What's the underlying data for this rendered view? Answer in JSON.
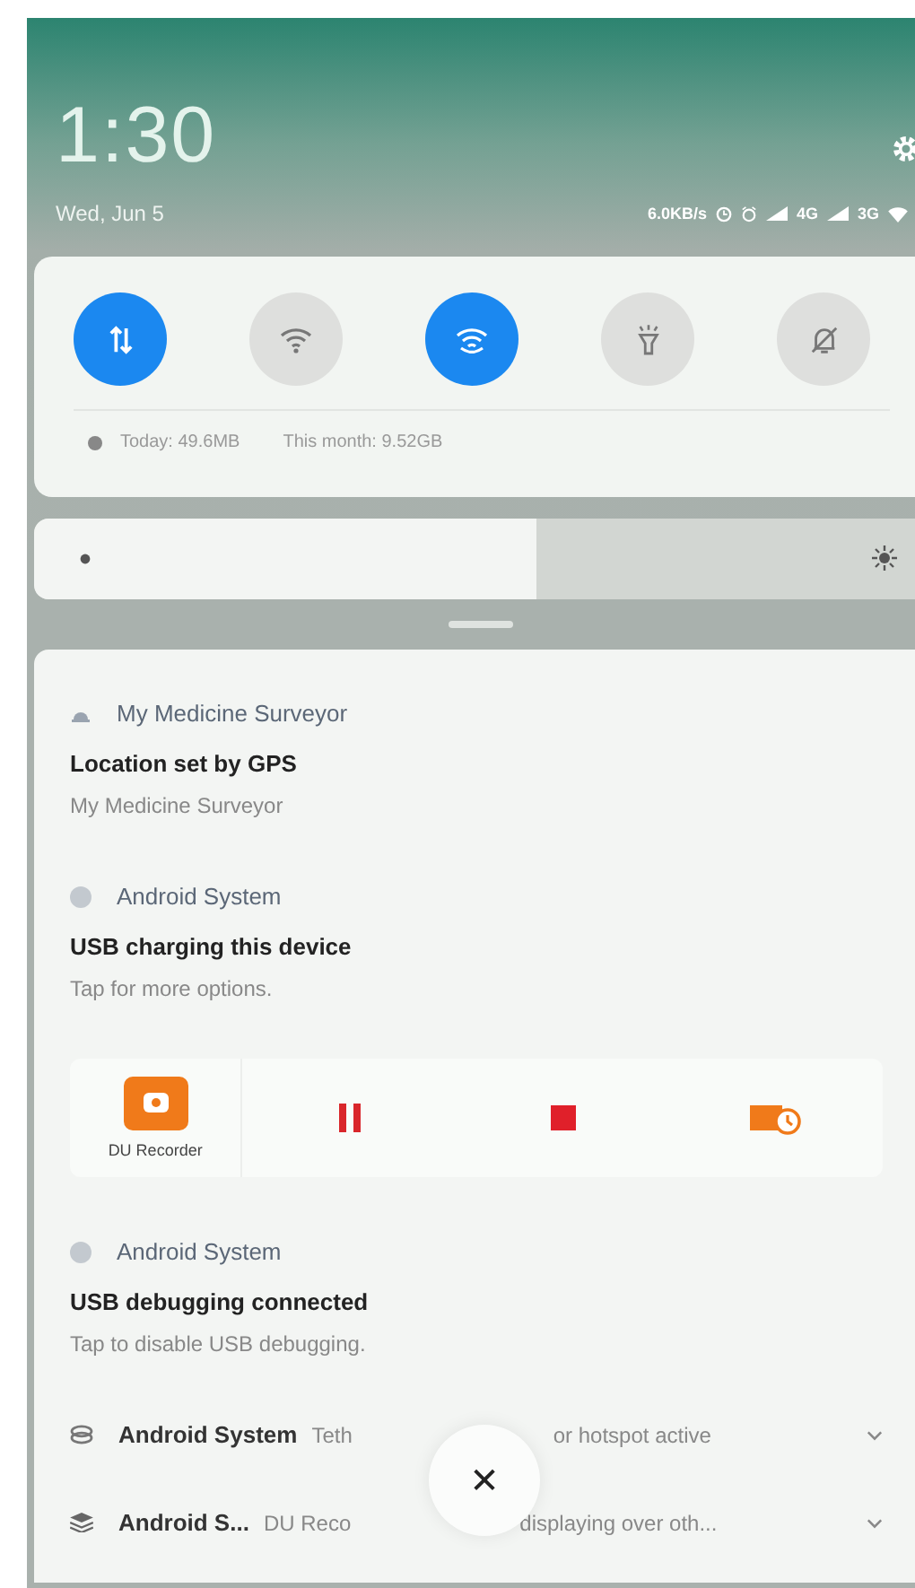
{
  "header": {
    "time": "1:30",
    "date": "Wed, Jun 5",
    "net_speed": "6.0KB/s",
    "network_1": "4G",
    "network_2": "3G"
  },
  "toggles": [
    {
      "on": true
    },
    {
      "on": false
    },
    {
      "on": true
    },
    {
      "on": false
    },
    {
      "on": false
    }
  ],
  "data_usage": {
    "today": "Today: 49.6MB",
    "month": "This month: 9.52GB"
  },
  "brightness": {
    "level": 0.57
  },
  "notifications": [
    {
      "kind": "expanded",
      "app": "My Medicine Surveyor",
      "title": "Location set by GPS",
      "text": "My Medicine Surveyor"
    },
    {
      "kind": "expanded",
      "app": "Android System",
      "title": "USB charging this device",
      "text": "Tap for more options."
    },
    {
      "kind": "media",
      "app": "DU Recorder"
    },
    {
      "kind": "expanded",
      "app": "Android System",
      "title": "USB debugging connected",
      "text": "Tap to disable USB debugging."
    },
    {
      "kind": "collapsed",
      "app": "Android System",
      "summary": [
        "Teth",
        "or hotspot active"
      ]
    },
    {
      "kind": "collapsed",
      "app": "Android S...",
      "summary": [
        "DU Reco",
        "displaying over oth..."
      ]
    }
  ],
  "close_button": "✕"
}
